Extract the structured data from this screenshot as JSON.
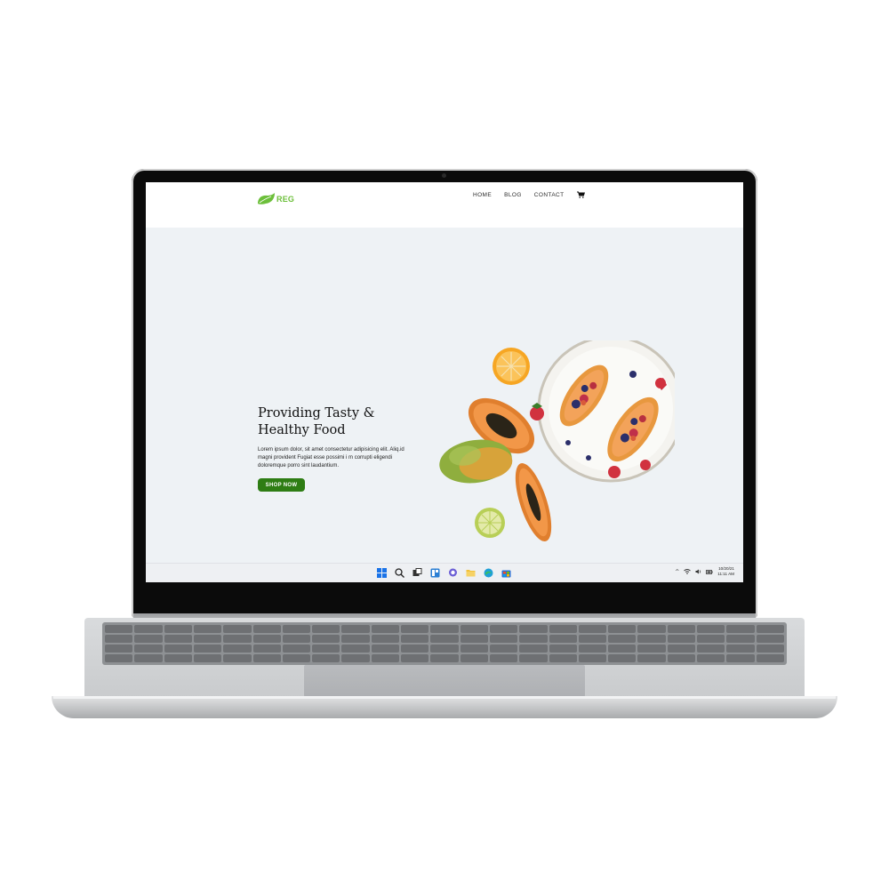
{
  "site": {
    "logo_text": "REG",
    "nav": [
      {
        "label": "HOME"
      },
      {
        "label": "BLOG"
      },
      {
        "label": "CONTACT"
      }
    ],
    "cart_icon": "cart-icon"
  },
  "hero": {
    "title_line1": "Providing Tasty &",
    "title_line2": "Healthy Food",
    "body": "Lorem ipsum dolor, sit amet consectetur adipisicing elit. Aliq.id magni provident Fugiat esse possimi i m corrupti eligendi doloremque porro sint laudantium.",
    "button_label": "SHOP NOW",
    "button_color": "#2e7d14"
  },
  "taskbar": {
    "icons": [
      "windows-start-icon",
      "search-icon",
      "task-view-icon",
      "widgets-icon",
      "chat-icon",
      "file-explorer-icon",
      "edge-browser-icon",
      "store-icon"
    ],
    "tray": {
      "chevron": "^",
      "date": "10/20/21",
      "time": "11:11 AM"
    }
  },
  "colors": {
    "accent": "#6cbf3a",
    "button": "#2e7d14",
    "hero_bg": "#eef2f5"
  }
}
